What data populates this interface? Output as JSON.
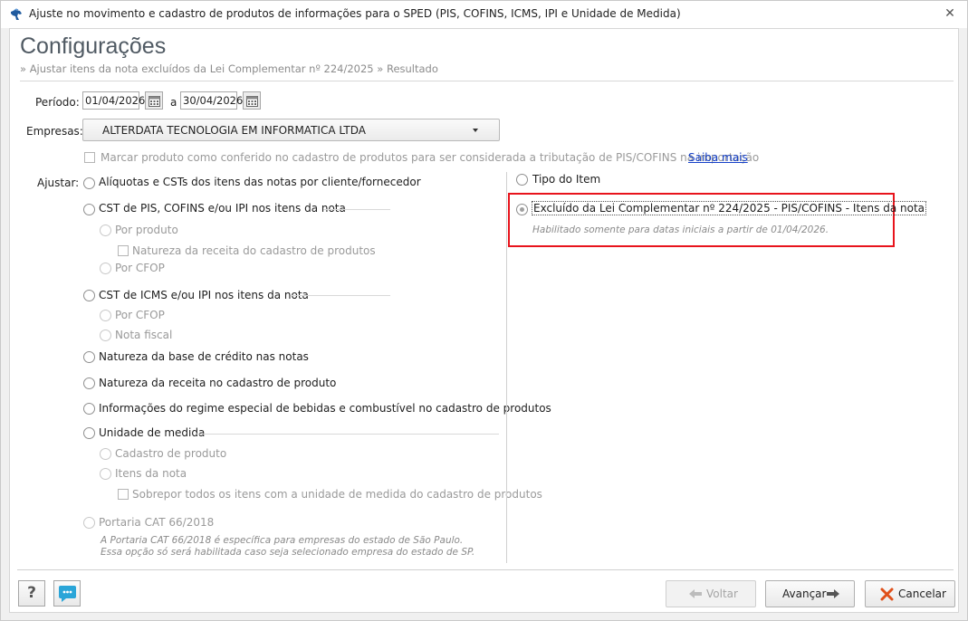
{
  "window": {
    "title": "Ajuste no movimento e cadastro de produtos de informações para o SPED (PIS, COFINS, ICMS, IPI e Unidade de Medida)",
    "close_glyph": "✕"
  },
  "header": {
    "title": "Configurações",
    "breadcrumb": "» Ajustar itens da nota excluídos da Lei Complementar nº 224/2025 » Resultado"
  },
  "period": {
    "label": "Período:",
    "start": "01/04/2026",
    "separator": "a",
    "end": "30/04/2026"
  },
  "company": {
    "label": "Empresas:",
    "selected": "ALTERDATA TECNOLOGIA EM INFORMATICA LTDA"
  },
  "mark_checked": {
    "label": "Marcar produto como conferido no cadastro de produtos para ser considerada a tributação de PIS/COFINS na importação",
    "link": "Saiba mais"
  },
  "adjust": {
    "label": "Ajustar:",
    "opt_aliquotas": "Alíquotas e CSTs dos itens das notas por cliente/fornecedor",
    "opt_cst_pis": "CST de PIS, COFINS e/ou IPI nos itens da nota",
    "sub_por_produto": "Por produto",
    "sub_natureza_cad": "Natureza da receita do cadastro de produtos",
    "sub_por_cfop_1": "Por CFOP",
    "opt_cst_icms": "CST de ICMS e/ou IPI nos itens da nota",
    "sub_por_cfop_2": "Por CFOP",
    "sub_nota_fiscal": "Nota fiscal",
    "opt_natureza_base": "Natureza da base de crédito nas notas",
    "opt_natureza_receita": "Natureza da receita no cadastro de produto",
    "opt_regime_especial": "Informações do regime especial de bebidas e combustível no cadastro de produtos",
    "opt_unidade": "Unidade de medida",
    "sub_cadastro_produto": "Cadastro de produto",
    "sub_itens_nota": "Itens da nota",
    "sub_sobrepor": "Sobrepor todos os itens com a unidade de medida do cadastro de produtos",
    "opt_portaria": "Portaria CAT 66/2018",
    "portaria_note_1": "A Portaria CAT 66/2018 é específica para empresas do estado de São Paulo.",
    "portaria_note_2": "Essa opção só será habilitada caso seja selecionado empresa do estado de SP."
  },
  "right": {
    "opt_tipo_item": "Tipo do Item",
    "opt_excluido": "Excluído da Lei Complementar nº 224/2025 - PIS/COFINS - Itens da nota",
    "excluido_note": "Habilitado somente para datas iniciais a partir de 01/04/2026."
  },
  "footer": {
    "help": "?",
    "back": "Voltar",
    "next": "Avançar",
    "cancel": "Cancelar"
  },
  "colors": {
    "highlight": "#e8141c",
    "link": "#1540c8",
    "cancel_icon": "#e0501a",
    "chat_icon": "#2aa5d8"
  }
}
